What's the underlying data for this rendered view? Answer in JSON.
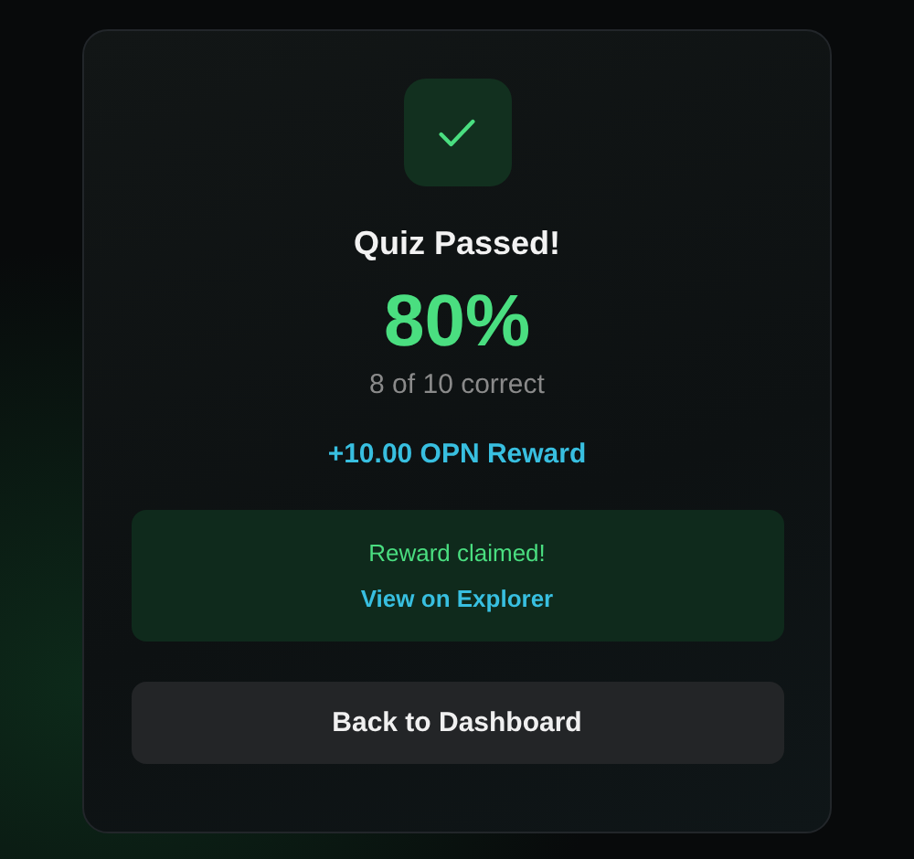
{
  "result": {
    "passed": true,
    "title": "Quiz Passed!",
    "score": "80%",
    "detail": "8 of 10 correct",
    "reward": "+10.00 OPN Reward"
  },
  "claim": {
    "message": "Reward claimed!",
    "link": "View on Explorer"
  },
  "button": "Back to Dashboard"
}
